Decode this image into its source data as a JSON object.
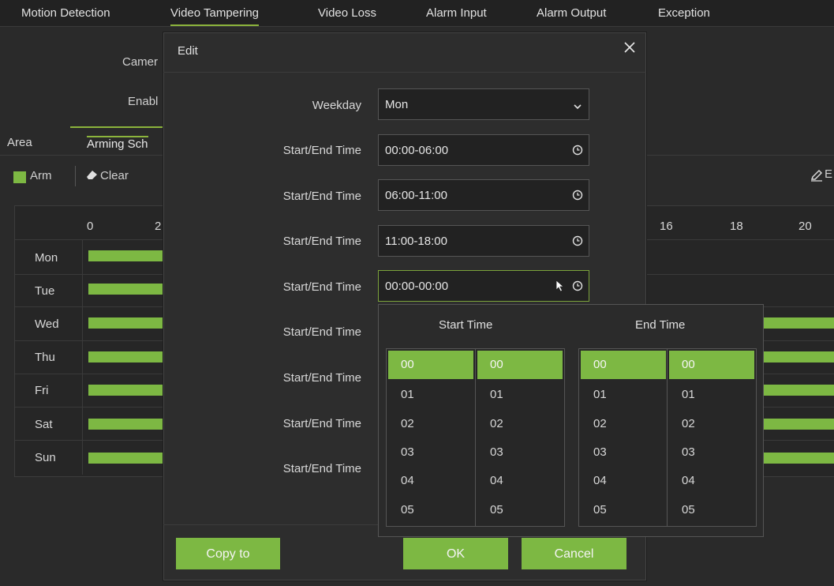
{
  "top_tabs": [
    {
      "label": "Motion Detection",
      "active": false
    },
    {
      "label": "Video Tampering",
      "active": true
    },
    {
      "label": "Video Loss",
      "active": false
    },
    {
      "label": "Alarm Input",
      "active": false
    },
    {
      "label": "Alarm Output",
      "active": false
    },
    {
      "label": "Exception",
      "active": false
    }
  ],
  "background": {
    "camera_label": "Camer",
    "enable_label": "Enabl",
    "sub_tabs": [
      {
        "label": "Area",
        "active": false
      },
      {
        "label": "Arming Sch",
        "active": true
      }
    ],
    "arm_label": "Arm",
    "clear_label": "Clear",
    "edit_label": "E",
    "hour_labels_left": [
      "0",
      "2"
    ],
    "hour_labels_right": [
      "16",
      "18",
      "20"
    ],
    "days": [
      "Mon",
      "Tue",
      "Wed",
      "Thu",
      "Fri",
      "Sat",
      "Sun"
    ],
    "accent_color": "#7db843"
  },
  "modal": {
    "title": "Edit",
    "weekday_label": "Weekday",
    "weekday_value": "Mon",
    "time_rows": [
      {
        "label": "Start/End Time",
        "value": "00:00-06:00"
      },
      {
        "label": "Start/End Time",
        "value": "06:00-11:00"
      },
      {
        "label": "Start/End Time",
        "value": "11:00-18:00"
      },
      {
        "label": "Start/End Time",
        "value": "00:00-00:00"
      },
      {
        "label": "Start/End Time",
        "value": ""
      },
      {
        "label": "Start/End Time",
        "value": ""
      },
      {
        "label": "Start/End Time",
        "value": ""
      },
      {
        "label": "Start/End Time",
        "value": ""
      }
    ],
    "copy_to_label": "Copy to",
    "ok_label": "OK",
    "cancel_label": "Cancel"
  },
  "picker": {
    "start_title": "Start Time",
    "end_title": "End Time",
    "options": [
      "00",
      "01",
      "02",
      "03",
      "04",
      "05"
    ],
    "selected": "00"
  }
}
